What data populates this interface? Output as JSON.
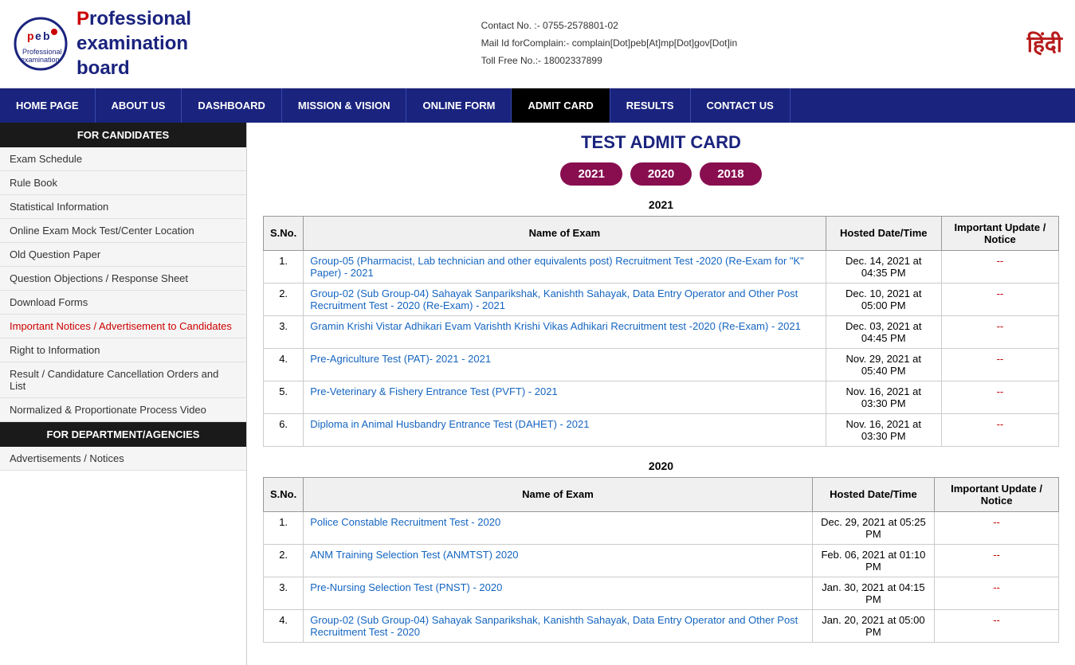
{
  "header": {
    "logo_initials": "peb",
    "logo_line1": "Professional",
    "logo_line2": "examination",
    "logo_line3": "board",
    "contact": "Contact No. :- 0755-2578801-02",
    "mail": "Mail Id forComplain:- complain[Dot]peb[At]mp[Dot]gov[Dot]in",
    "toll_free": "Toll Free No.:- 18002337899",
    "hindi_label": "हिंदी"
  },
  "nav": {
    "items": [
      {
        "label": "HOME PAGE",
        "active": false
      },
      {
        "label": "ABOUT US",
        "active": false
      },
      {
        "label": "DASHBOARD",
        "active": false
      },
      {
        "label": "MISSION & VISION",
        "active": false
      },
      {
        "label": "ONLINE FORM",
        "active": false
      },
      {
        "label": "ADMIT CARD",
        "active": true
      },
      {
        "label": "RESULTS",
        "active": false
      },
      {
        "label": "CONTACT US",
        "active": false
      }
    ]
  },
  "sidebar": {
    "for_candidates_header": "FOR CANDIDATES",
    "candidates_items": [
      "Exam Schedule",
      "Rule Book",
      "Statistical Information",
      "Online Exam Mock Test/Center Location",
      "Old Question Paper",
      "Question Objections / Response Sheet",
      "Download Forms",
      "Important Notices / Advertisement to Candidates",
      "Right to Information",
      "Result / Candidature Cancellation Orders and List",
      "Normalized & Proportionate Process Video"
    ],
    "for_dept_header": "FOR DEPARTMENT/AGENCIES",
    "dept_items": [
      "Advertisements / Notices"
    ]
  },
  "main": {
    "title": "TEST ADMIT CARD",
    "year_buttons": [
      "2021",
      "2020",
      "2018"
    ],
    "section_2021": "2021",
    "table_2021_headers": [
      "S.No.",
      "Name of Exam",
      "Hosted Date/Time",
      "Important Update / Notice"
    ],
    "rows_2021": [
      {
        "sno": "1.",
        "name": "Group-05 (Pharmacist, Lab technician and other equivalents post) Recruitment Test -2020 (Re-Exam for \"K\" Paper) - 2021",
        "date": "Dec. 14, 2021 at 04:35 PM",
        "notice": "--"
      },
      {
        "sno": "2.",
        "name": "Group-02 (Sub Group-04) Sahayak Sanparikshak, Kanishth Sahayak, Data Entry Operator and Other Post Recruitment Test - 2020 (Re-Exam) - 2021",
        "date": "Dec. 10, 2021 at 05:00 PM",
        "notice": "--"
      },
      {
        "sno": "3.",
        "name": "Gramin Krishi Vistar Adhikari Evam Varishth Krishi Vikas Adhikari Recruitment test -2020 (Re-Exam) - 2021",
        "date": "Dec. 03, 2021 at 04:45 PM",
        "notice": "--"
      },
      {
        "sno": "4.",
        "name": "Pre-Agriculture Test (PAT)- 2021 - 2021",
        "date": "Nov. 29, 2021 at 05:40 PM",
        "notice": "--"
      },
      {
        "sno": "5.",
        "name": "Pre-Veterinary & Fishery Entrance Test (PVFT) - 2021",
        "date": "Nov. 16, 2021 at 03:30 PM",
        "notice": "--"
      },
      {
        "sno": "6.",
        "name": "Diploma in Animal Husbandry Entrance Test (DAHET) - 2021",
        "date": "Nov. 16, 2021 at 03:30 PM",
        "notice": "--"
      }
    ],
    "section_2020": "2020",
    "table_2020_headers": [
      "S.No.",
      "Name of Exam",
      "Hosted Date/Time",
      "Important Update / Notice"
    ],
    "rows_2020": [
      {
        "sno": "1.",
        "name": "Police Constable Recruitment Test - 2020",
        "date": "Dec. 29, 2021 at 05:25 PM",
        "notice": "--"
      },
      {
        "sno": "2.",
        "name": "ANM Training Selection Test (ANMTST) 2020",
        "date": "Feb. 06, 2021 at 01:10 PM",
        "notice": "--"
      },
      {
        "sno": "3.",
        "name": "Pre-Nursing Selection Test (PNST) - 2020",
        "date": "Jan. 30, 2021 at 04:15 PM",
        "notice": "--"
      },
      {
        "sno": "4.",
        "name": "Group-02 (Sub Group-04) Sahayak Sanparikshak, Kanishth Sahayak, Data Entry Operator and Other Post Recruitment Test - 2020",
        "date": "Jan. 20, 2021 at 05:00 PM",
        "notice": "--"
      }
    ]
  }
}
